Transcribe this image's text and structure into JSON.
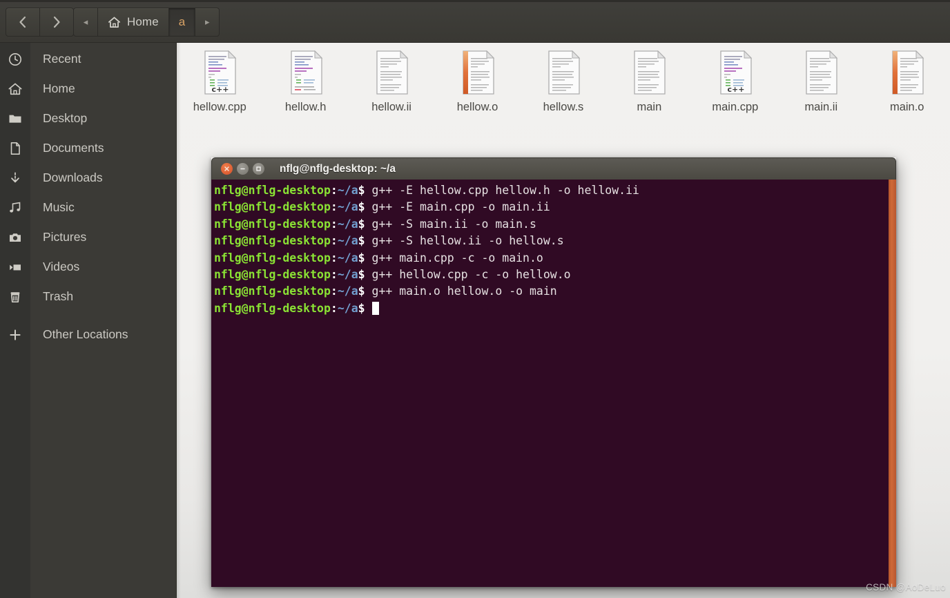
{
  "window": {
    "app": "files-manager"
  },
  "header": {
    "nav": {
      "back_icon": "chevron-left-icon",
      "forward_icon": "chevron-right-icon"
    },
    "breadcrumb": {
      "left_arrow_label": "◂",
      "right_arrow_label": "▸",
      "items": [
        {
          "label": "Home",
          "icon": "home-icon",
          "active": false
        },
        {
          "label": "a",
          "icon": "",
          "active": true
        }
      ]
    }
  },
  "sidebar": {
    "items": [
      {
        "label": "Recent",
        "icon": "clock-icon"
      },
      {
        "label": "Home",
        "icon": "home-icon"
      },
      {
        "label": "Desktop",
        "icon": "folder-icon"
      },
      {
        "label": "Documents",
        "icon": "document-icon"
      },
      {
        "label": "Downloads",
        "icon": "download-icon"
      },
      {
        "label": "Music",
        "icon": "music-note-icon"
      },
      {
        "label": "Pictures",
        "icon": "camera-icon"
      },
      {
        "label": "Videos",
        "icon": "video-icon"
      },
      {
        "label": "Trash",
        "icon": "trash-icon"
      },
      {
        "label": "Other Locations",
        "icon": "plus-icon"
      }
    ]
  },
  "files": [
    {
      "name": "hellow.cpp",
      "kind": "cpp"
    },
    {
      "name": "hellow.h",
      "kind": "header"
    },
    {
      "name": "hellow.ii",
      "kind": "text"
    },
    {
      "name": "hellow.o",
      "kind": "binary"
    },
    {
      "name": "hellow.s",
      "kind": "text"
    },
    {
      "name": "main",
      "kind": "text"
    },
    {
      "name": "main.cpp",
      "kind": "cpp"
    },
    {
      "name": "main.ii",
      "kind": "text"
    },
    {
      "name": "main.o",
      "kind": "binary"
    }
  ],
  "terminal": {
    "title": "nflg@nflg-desktop: ~/a",
    "buttons": {
      "close": "close-icon",
      "minimize": "minimize-icon",
      "maximize": "maximize-icon"
    },
    "prompt": {
      "user_host": "nflg@nflg-desktop",
      "colon": ":",
      "path": "~/a",
      "dollar": "$"
    },
    "lines": [
      "g++ -E hellow.cpp hellow.h -o hellow.ii",
      "g++ -E main.cpp -o main.ii",
      "g++ -S main.ii -o main.s",
      "g++ -S hellow.ii -o hellow.s",
      "g++ main.cpp -c -o main.o",
      "g++ hellow.cpp -c -o hellow.o",
      "g++ main.o hellow.o -o main",
      ""
    ],
    "cursor_visible": true
  },
  "watermark": {
    "text": "CSDN @AoDeLuo"
  },
  "colors": {
    "terminal_bg": "#300a24",
    "prompt_green": "#8ae234",
    "prompt_blue": "#729fcf",
    "scrollbar_orange": "#cf6a38",
    "sidebar_bg": "#3b3a36",
    "header_bg": "#3e3d39",
    "file_area_bg": "#f2f1ef",
    "accent": "#d8a366"
  }
}
